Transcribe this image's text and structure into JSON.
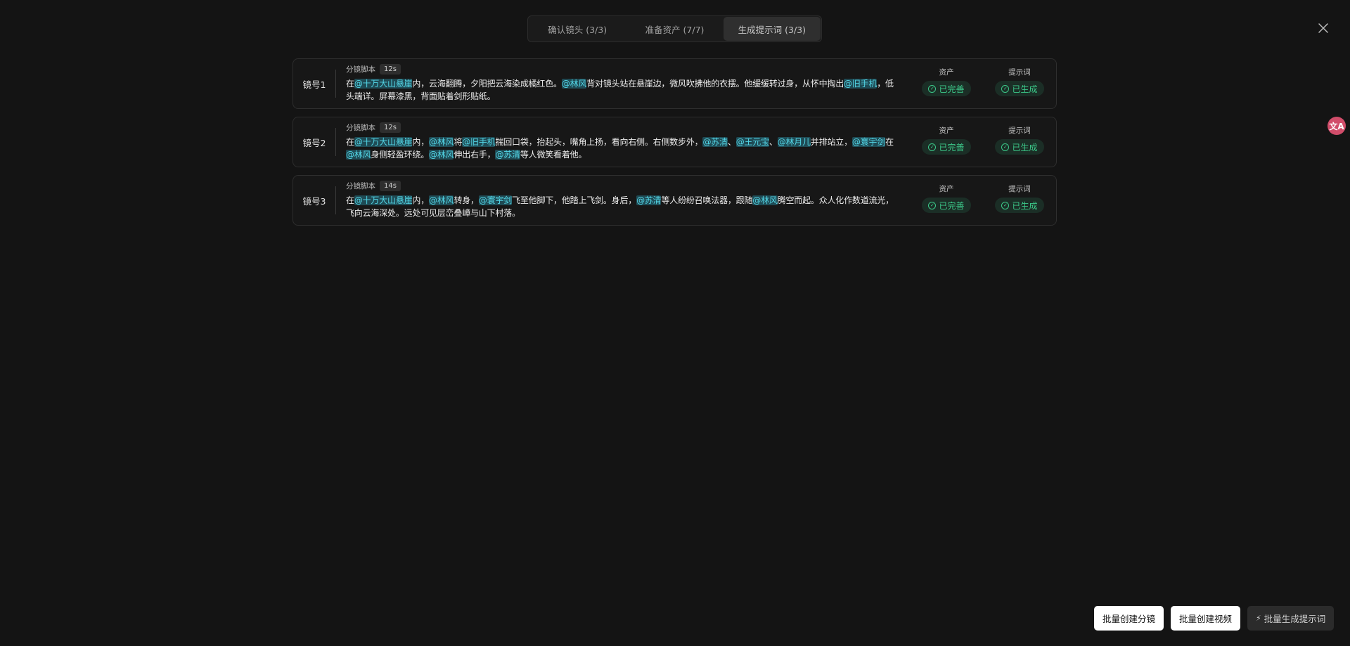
{
  "tabs": [
    {
      "label": "确认镜头 (3/3)"
    },
    {
      "label": "准备资产 (7/7)"
    },
    {
      "label": "生成提示词 (3/3)"
    }
  ],
  "active_tab": 2,
  "close_icon": "close-icon",
  "floating_button": {
    "icon": "translate-icon",
    "glyph": "文A"
  },
  "columns": {
    "asset": "资产",
    "prompt": "提示词"
  },
  "script_label": "分镜脚本",
  "shots": [
    {
      "label": "镜号1",
      "duration": "12s",
      "asset_status": "已完善",
      "prompt_status": "已生成",
      "script": [
        {
          "t": "在"
        },
        {
          "m": "@十万大山悬崖"
        },
        {
          "t": "内，云海翻腾，夕阳把云海染成橘红色。"
        },
        {
          "m": "@林风"
        },
        {
          "t": "背对镜头站在悬崖边，微风吹拂他的衣摆。他缓缓转过身，从怀中掏出"
        },
        {
          "m": "@旧手机"
        },
        {
          "t": "，低头端详。屏幕漆黑，背面贴着剑形贴纸。"
        }
      ]
    },
    {
      "label": "镜号2",
      "duration": "12s",
      "asset_status": "已完善",
      "prompt_status": "已生成",
      "script": [
        {
          "t": "在"
        },
        {
          "m": "@十万大山悬崖"
        },
        {
          "t": "内，"
        },
        {
          "m": "@林风"
        },
        {
          "t": "将"
        },
        {
          "m": "@旧手机"
        },
        {
          "t": "揣回口袋，抬起头，嘴角上扬，看向右侧。右侧数步外，"
        },
        {
          "m": "@苏清"
        },
        {
          "t": "、"
        },
        {
          "m": "@王元宝"
        },
        {
          "t": "、"
        },
        {
          "m": "@林月儿"
        },
        {
          "t": "并排站立，"
        },
        {
          "m": "@寰宇剑"
        },
        {
          "t": "在"
        },
        {
          "m": "@林风"
        },
        {
          "t": "身侧轻盈环绕。"
        },
        {
          "m": "@林风"
        },
        {
          "t": "伸出右手，"
        },
        {
          "m": "@苏清"
        },
        {
          "t": "等人微笑看着他。"
        }
      ]
    },
    {
      "label": "镜号3",
      "duration": "14s",
      "asset_status": "已完善",
      "prompt_status": "已生成",
      "script": [
        {
          "t": "在"
        },
        {
          "m": "@十万大山悬崖"
        },
        {
          "t": "内，"
        },
        {
          "m": "@林风"
        },
        {
          "t": "转身，"
        },
        {
          "m": "@寰宇剑"
        },
        {
          "t": "飞至他脚下，他踏上飞剑。身后，"
        },
        {
          "m": "@苏清"
        },
        {
          "t": "等人纷纷召唤法器，跟随"
        },
        {
          "m": "@林风"
        },
        {
          "t": "腾空而起。众人化作数道流光，飞向云海深处。远处可见层峦叠嶂与山下村落。"
        }
      ]
    }
  ],
  "actions": {
    "batch_storyboard": "批量创建分镜",
    "batch_video": "批量创建视频",
    "batch_prompt": "批量生成提示词"
  },
  "colors": {
    "background": "#141414",
    "mention": "#53d6e6",
    "status_green": "#3cc98a"
  }
}
